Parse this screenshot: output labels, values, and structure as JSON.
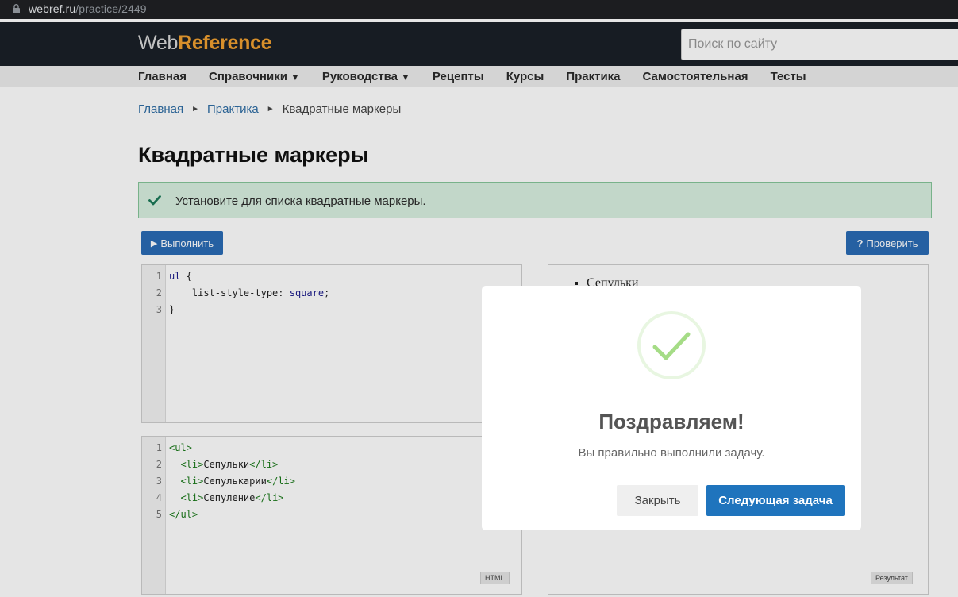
{
  "browser": {
    "url_host": "webref.ru",
    "url_path": "/practice/2449"
  },
  "header": {
    "logo_part1": "Web",
    "logo_part2": "Reference",
    "search_placeholder": "Поиск по сайту"
  },
  "nav": {
    "items": [
      {
        "label": "Главная",
        "dropdown": false
      },
      {
        "label": "Справочники",
        "dropdown": true
      },
      {
        "label": "Руководства",
        "dropdown": true
      },
      {
        "label": "Рецепты",
        "dropdown": false
      },
      {
        "label": "Курсы",
        "dropdown": false
      },
      {
        "label": "Практика",
        "dropdown": false
      },
      {
        "label": "Самостоятельная",
        "dropdown": false
      },
      {
        "label": "Тесты",
        "dropdown": false
      }
    ],
    "dropdown_glyph": "▼"
  },
  "breadcrumb": {
    "items": [
      "Главная",
      "Практика"
    ],
    "current": "Квадратные маркеры",
    "separator": "►"
  },
  "page": {
    "title": "Квадратные маркеры",
    "task_text": "Установите для списка квадратные маркеры."
  },
  "toolbar": {
    "run_label": "Выполнить",
    "check_label": "Проверить"
  },
  "css_editor": {
    "line_numbers": [
      "1",
      "2",
      "3"
    ]
  },
  "html_editor": {
    "line_numbers": [
      "1",
      "2",
      "3",
      "4",
      "5"
    ],
    "tag_label": "HTML"
  },
  "result": {
    "items": [
      "Сепульки"
    ],
    "tag_label": "Результат"
  },
  "modal": {
    "headline": "Поздравляем!",
    "message": "Вы правильно выполнили задачу.",
    "close_label": "Закрыть",
    "next_label": "Следующая задача",
    "success_color": "#a5dc86"
  },
  "colors": {
    "header_bg": "#1a2027",
    "logo_accent": "#f0a030",
    "primary_button": "#2a6bb5",
    "task_bg": "#d9f0e0"
  }
}
